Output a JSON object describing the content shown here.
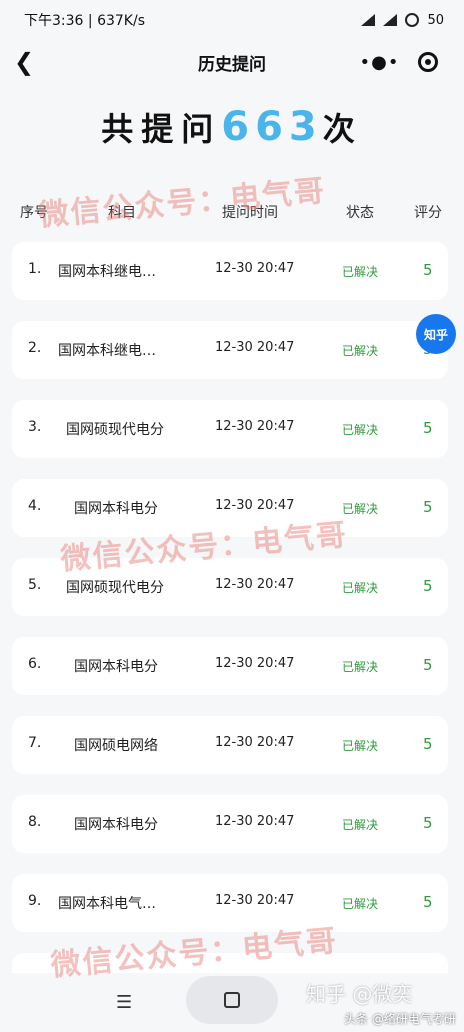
{
  "status_bar": {
    "time": "下午3:36",
    "speed": "637K/s",
    "battery": "50"
  },
  "nav": {
    "title": "历史提问"
  },
  "summary": {
    "prefix": "共提问",
    "count": "663",
    "suffix": "次"
  },
  "table": {
    "headers": [
      "序号",
      "科目",
      "提问时间",
      "状态",
      "评分"
    ],
    "rows": [
      {
        "idx": "1.",
        "subject": "国网本科继电…",
        "time": "12-30 20:47",
        "status": "已解决",
        "score": "5"
      },
      {
        "idx": "2.",
        "subject": "国网本科继电…",
        "time": "12-30 20:47",
        "status": "已解决",
        "score": "5"
      },
      {
        "idx": "3.",
        "subject": "国网硕现代电分",
        "time": "12-30 20:47",
        "status": "已解决",
        "score": "5"
      },
      {
        "idx": "4.",
        "subject": "国网本科电分",
        "time": "12-30 20:47",
        "status": "已解决",
        "score": "5"
      },
      {
        "idx": "5.",
        "subject": "国网硕现代电分",
        "time": "12-30 20:47",
        "status": "已解决",
        "score": "5"
      },
      {
        "idx": "6.",
        "subject": "国网本科电分",
        "time": "12-30 20:47",
        "status": "已解决",
        "score": "5"
      },
      {
        "idx": "7.",
        "subject": "国网硕电网络",
        "time": "12-30 20:47",
        "status": "已解决",
        "score": "5"
      },
      {
        "idx": "8.",
        "subject": "国网本科电分",
        "time": "12-30 20:47",
        "status": "已解决",
        "score": "5"
      },
      {
        "idx": "9.",
        "subject": "国网本科电气…",
        "time": "12-30 20:47",
        "status": "已解决",
        "score": "5"
      }
    ]
  },
  "watermark": "微信公众号：电气哥",
  "badge": "知乎",
  "credits": {
    "zhihu": "知乎 @微奕",
    "toutiao": "头条 @络研电气考研"
  },
  "colors": {
    "count": "#4ab5ea",
    "status": "#2f9b3c",
    "badge": "#1677ee"
  }
}
